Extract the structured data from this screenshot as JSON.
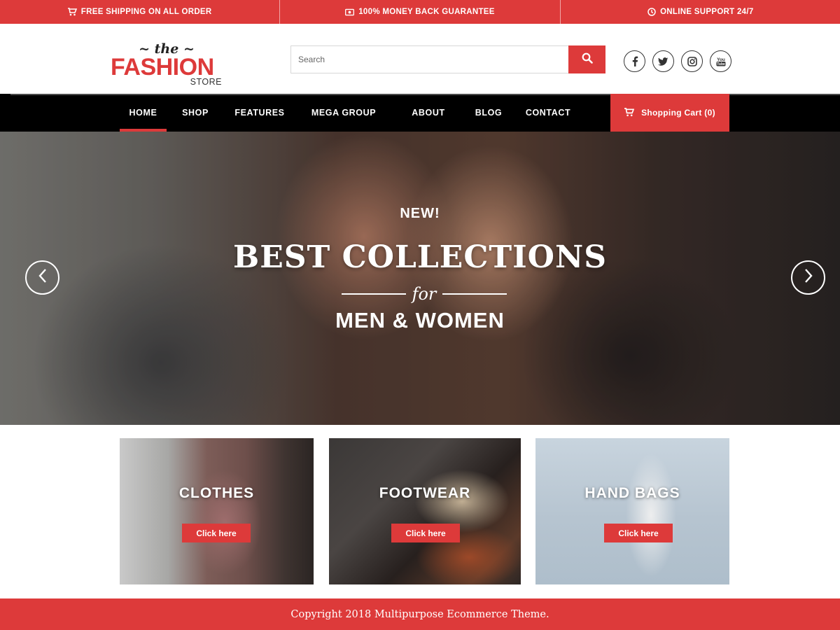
{
  "topbar": {
    "items": [
      {
        "icon": "truck-icon",
        "label": "FREE SHIPPING ON ALL ORDER"
      },
      {
        "icon": "money-icon",
        "label": "100% MONEY BACK GUARANTEE"
      },
      {
        "icon": "clock-icon",
        "label": "ONLINE SUPPORT 24/7"
      }
    ]
  },
  "logo": {
    "the": "~ the ~",
    "fashion": "FASHION",
    "store": "STORE"
  },
  "search": {
    "placeholder": "Search",
    "button_icon": "search-icon"
  },
  "socials": [
    {
      "name": "facebook-icon",
      "glyph": "f"
    },
    {
      "name": "twitter-icon",
      "glyph": "twitter"
    },
    {
      "name": "instagram-icon",
      "glyph": "instagram"
    },
    {
      "name": "youtube-icon",
      "glyph": "You"
    }
  ],
  "nav": {
    "items": [
      "HOME",
      "SHOP",
      "FEATURES",
      "MEGA GROUP",
      "ABOUT",
      "BLOG",
      "CONTACT"
    ],
    "active": "HOME",
    "cart_label": "Shopping Cart (0)"
  },
  "hero": {
    "new": "NEW!",
    "title": "BEST COLLECTIONS",
    "for": "for",
    "subtitle": "MEN & WOMEN"
  },
  "categories": [
    {
      "title": "CLOTHES",
      "button": "Click here"
    },
    {
      "title": "FOOTWEAR",
      "button": "Click here"
    },
    {
      "title": "HAND BAGS",
      "button": "Click here"
    }
  ],
  "footer": {
    "text": "Copyright 2018 Multipurpose Ecommerce Theme."
  },
  "colors": {
    "accent": "#dd3a3a",
    "nav_bg": "#000000",
    "text": "#ffffff"
  }
}
